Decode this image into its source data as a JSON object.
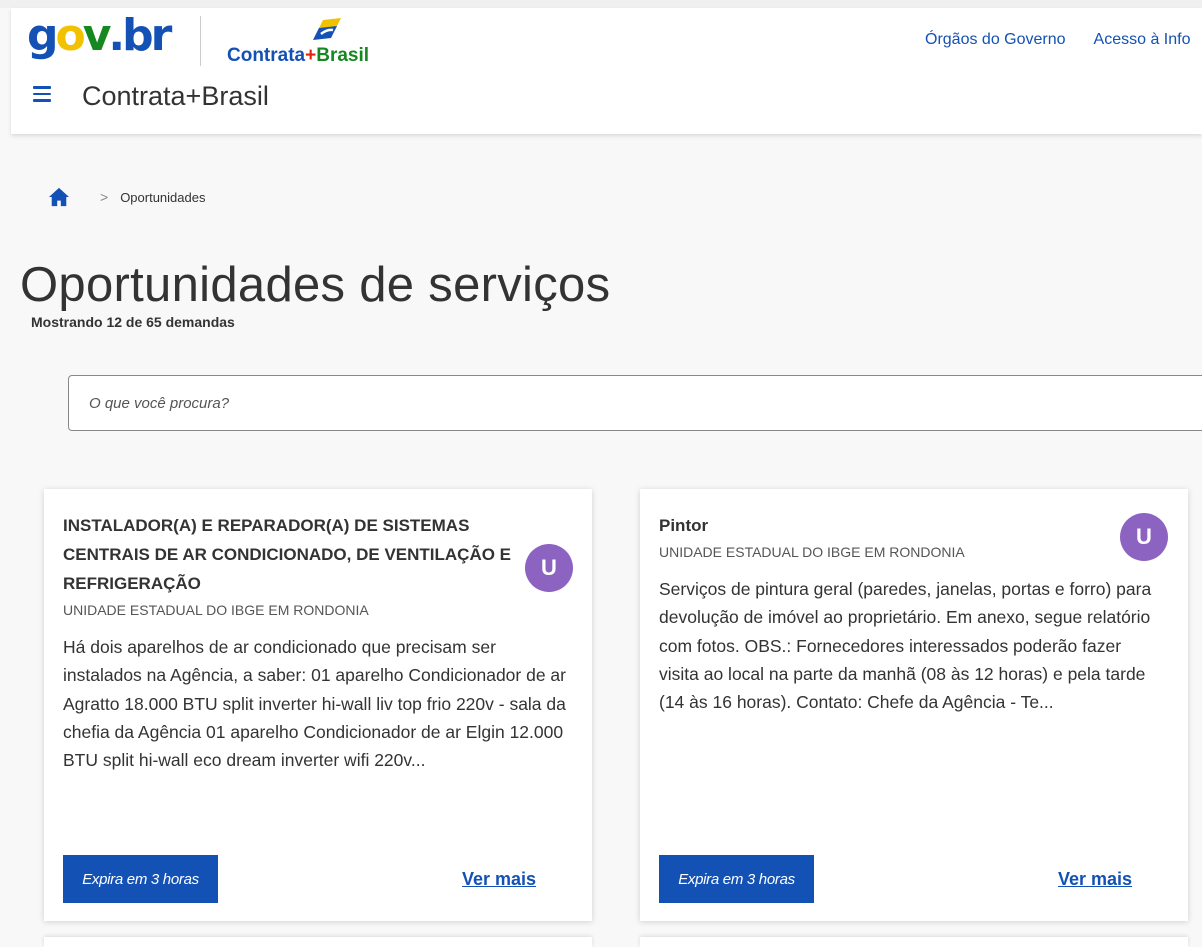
{
  "header": {
    "govbr_logo": "gov.br",
    "brand_logo": "Contrata+Brasil",
    "title": "Contrata+Brasil",
    "links": [
      "Órgãos do Governo",
      "Acesso à Info"
    ]
  },
  "breadcrumb": {
    "current": "Oportunidades"
  },
  "page": {
    "title": "Oportunidades de serviços",
    "results_count": "Mostrando 12 de 65 demandas"
  },
  "search": {
    "placeholder": "O que você procura?",
    "value": ""
  },
  "cards": [
    {
      "title": "INSTALADOR(A) E REPARADOR(A) DE SISTEMAS CENTRAIS DE AR CONDICIONADO, DE VENTILAÇÃO E REFRIGERAÇÃO",
      "organization": "UNIDADE ESTADUAL DO IBGE EM RONDONIA",
      "avatar_letter": "U",
      "description": "Há dois aparelhos de ar condicionado que precisam ser instalados na Agência, a saber: 01 aparelho Condicionador de ar Agratto 18.000 BTU split inverter hi-wall liv top frio 220v - sala da chefia da Agência 01 aparelho Condicionador de ar Elgin 12.000 BTU split hi-wall eco dream inverter wifi 220v...",
      "expires": "Expira em 3 horas",
      "action": "Ver mais"
    },
    {
      "title": "Pintor",
      "organization": "UNIDADE ESTADUAL DO IBGE EM RONDONIA",
      "avatar_letter": "U",
      "description": "Serviços de pintura geral (paredes, janelas, portas e forro) para devolução de imóvel ao proprietário. Em anexo, segue relatório com fotos. OBS.: Fornecedores interessados poderão fazer visita ao local na parte da manhã (08 às 12 horas) e pela tarde (14 às 16 horas). Contato: Chefe da Agência - Te...",
      "expires": "Expira em 3 horas",
      "action": "Ver mais"
    }
  ],
  "colors": {
    "primary_blue": "#1351b4",
    "avatar_purple": "#8d63c1",
    "brand_green": "#168821",
    "brand_yellow": "#f2c200",
    "brand_red": "#e52207"
  },
  "icons": {
    "menu": "menu-icon",
    "home": "home-icon",
    "breadcrumb_separator": "chevron-right-icon"
  }
}
